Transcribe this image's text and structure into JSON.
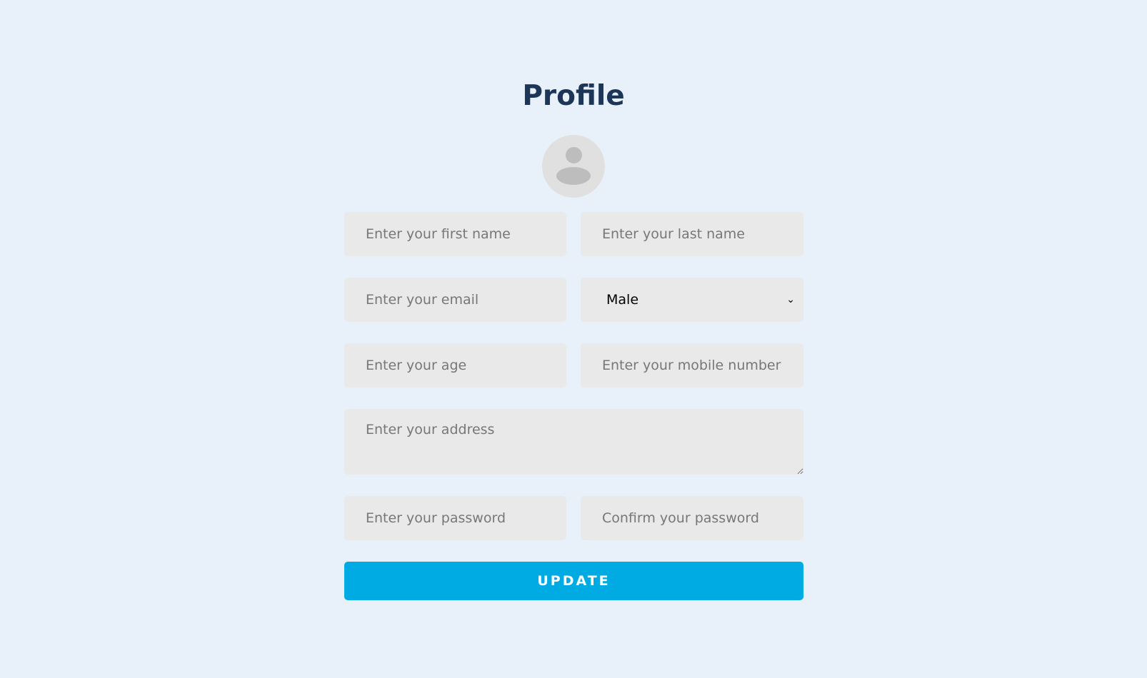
{
  "title": "Profile",
  "avatar_icon": "user-icon",
  "fields": {
    "first_name": "Enter your first name",
    "last_name": "Enter your last name",
    "email": "Enter your email",
    "gender": "Male",
    "age": "Enter your age",
    "mobile": "Enter your mobile number",
    "address": "Enter your address",
    "password": "Enter your password",
    "confirm_password": "Confirm your password"
  },
  "update_label": "UPDATE",
  "colors": {
    "background": "#e8f1fa",
    "title": "#1d3557",
    "button": "#00aae2",
    "input": "#e9e9e9"
  }
}
